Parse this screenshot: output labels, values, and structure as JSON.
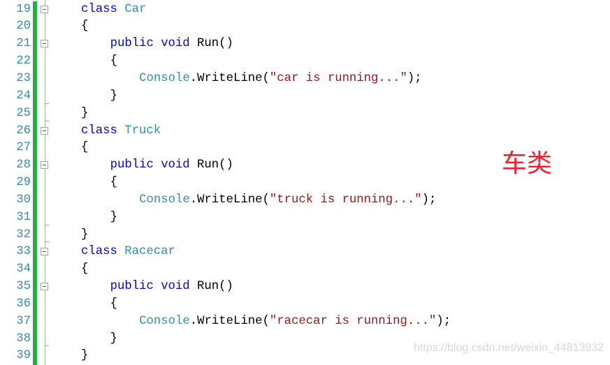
{
  "editor": {
    "lines": [
      {
        "n": "19",
        "indent": 0,
        "fold": "box",
        "tokens": [
          [
            "kw",
            "class "
          ],
          [
            "ty",
            "Car"
          ]
        ]
      },
      {
        "n": "20",
        "indent": 0,
        "fold": "line",
        "tokens": [
          [
            "pl",
            "{"
          ]
        ]
      },
      {
        "n": "21",
        "indent": 1,
        "fold": "box",
        "tokens": [
          [
            "kw",
            "public "
          ],
          [
            "kw",
            "void "
          ],
          [
            "pl",
            "Run()"
          ]
        ]
      },
      {
        "n": "22",
        "indent": 1,
        "fold": "line",
        "tokens": [
          [
            "pl",
            "{"
          ]
        ]
      },
      {
        "n": "23",
        "indent": 2,
        "fold": "line",
        "tokens": [
          [
            "ty",
            "Console"
          ],
          [
            "pl",
            ".WriteLine("
          ],
          [
            "st",
            "\"car is running...\""
          ],
          [
            "pl",
            ");"
          ]
        ]
      },
      {
        "n": "24",
        "indent": 1,
        "fold": "end",
        "tokens": [
          [
            "pl",
            "}"
          ]
        ]
      },
      {
        "n": "25",
        "indent": 0,
        "fold": "end",
        "tokens": [
          [
            "pl",
            "}"
          ]
        ]
      },
      {
        "n": "26",
        "indent": 0,
        "fold": "box",
        "tokens": [
          [
            "kw",
            "class "
          ],
          [
            "ty",
            "Truck"
          ]
        ]
      },
      {
        "n": "27",
        "indent": 0,
        "fold": "line",
        "tokens": [
          [
            "pl",
            "{"
          ]
        ]
      },
      {
        "n": "28",
        "indent": 1,
        "fold": "box",
        "tokens": [
          [
            "kw",
            "public "
          ],
          [
            "kw",
            "void "
          ],
          [
            "pl",
            "Run()"
          ]
        ]
      },
      {
        "n": "29",
        "indent": 1,
        "fold": "line",
        "tokens": [
          [
            "pl",
            "{"
          ]
        ]
      },
      {
        "n": "30",
        "indent": 2,
        "fold": "line",
        "tokens": [
          [
            "ty",
            "Console"
          ],
          [
            "pl",
            ".WriteLine("
          ],
          [
            "st",
            "\"truck is running...\""
          ],
          [
            "pl",
            ");"
          ]
        ]
      },
      {
        "n": "31",
        "indent": 1,
        "fold": "end",
        "tokens": [
          [
            "pl",
            "}"
          ]
        ]
      },
      {
        "n": "32",
        "indent": 0,
        "fold": "end",
        "tokens": [
          [
            "pl",
            "}"
          ]
        ]
      },
      {
        "n": "33",
        "indent": 0,
        "fold": "box",
        "tokens": [
          [
            "kw",
            "class "
          ],
          [
            "ty",
            "Racecar"
          ]
        ]
      },
      {
        "n": "34",
        "indent": 0,
        "fold": "line",
        "tokens": [
          [
            "pl",
            "{"
          ]
        ]
      },
      {
        "n": "35",
        "indent": 1,
        "fold": "box",
        "tokens": [
          [
            "kw",
            "public "
          ],
          [
            "kw",
            "void "
          ],
          [
            "pl",
            "Run()"
          ]
        ]
      },
      {
        "n": "36",
        "indent": 1,
        "fold": "line",
        "tokens": [
          [
            "pl",
            "{"
          ]
        ]
      },
      {
        "n": "37",
        "indent": 2,
        "fold": "line",
        "tokens": [
          [
            "ty",
            "Console"
          ],
          [
            "pl",
            ".WriteLine("
          ],
          [
            "st",
            "\"racecar is running...\""
          ],
          [
            "pl",
            ");"
          ]
        ]
      },
      {
        "n": "38",
        "indent": 1,
        "fold": "end",
        "tokens": [
          [
            "pl",
            "}"
          ]
        ]
      },
      {
        "n": "39",
        "indent": 0,
        "fold": "line",
        "tokens": [
          [
            "pl",
            "}"
          ]
        ]
      }
    ]
  },
  "annotation": "车类",
  "watermark": "https://blog.csdn.net/weixin_44813932",
  "colors": {
    "keyword": "#0000ff",
    "type": "#2b91af",
    "string": "#a31515",
    "changed_bar": "#1db43c",
    "annotation": "#f2202c"
  }
}
